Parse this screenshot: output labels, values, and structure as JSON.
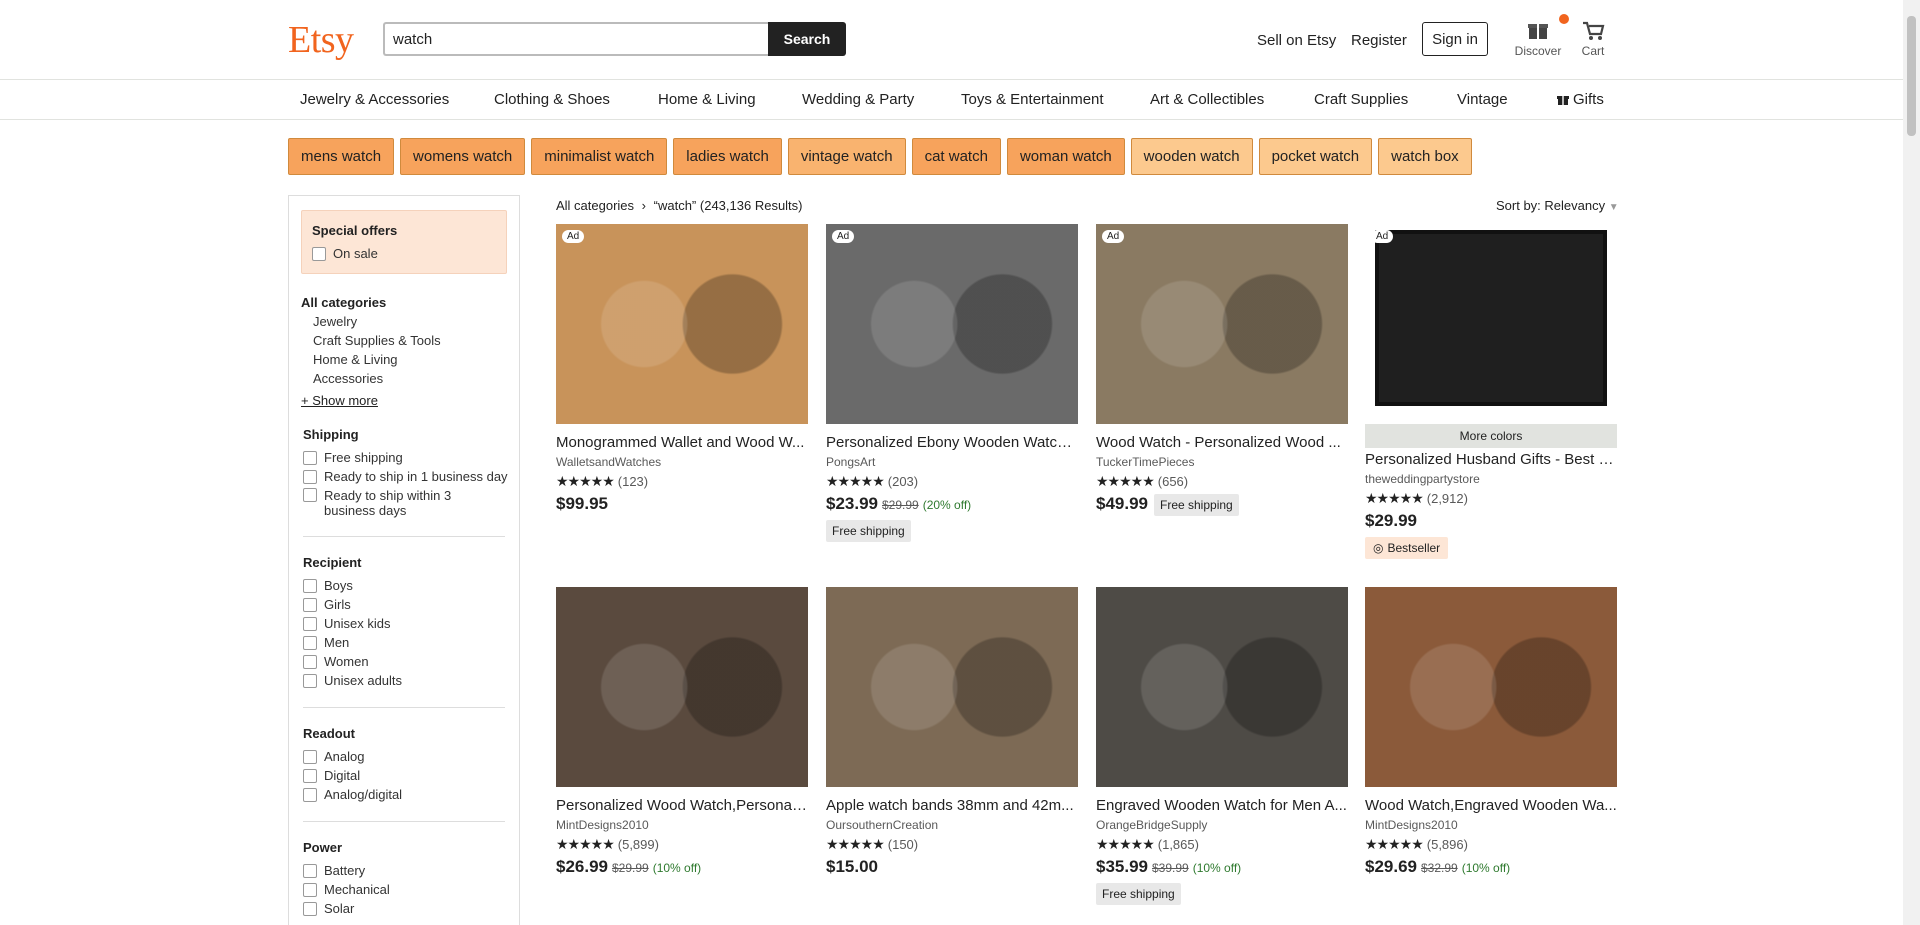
{
  "header": {
    "logo": "Etsy",
    "search_value": "watch",
    "search_button": "Search",
    "sell": "Sell on Etsy",
    "register": "Register",
    "signin": "Sign in",
    "discover": "Discover",
    "cart": "Cart"
  },
  "nav": {
    "categories": [
      "Jewelry & Accessories",
      "Clothing & Shoes",
      "Home & Living",
      "Wedding & Party",
      "Toys & Entertainment",
      "Art & Collectibles",
      "Craft Supplies",
      "Vintage",
      "Gifts"
    ]
  },
  "related_searches": [
    {
      "label": "mens watch",
      "color": "#f7a35c"
    },
    {
      "label": "womens watch",
      "color": "#f7a35c"
    },
    {
      "label": "minimalist watch",
      "color": "#f7a35c"
    },
    {
      "label": "ladies watch",
      "color": "#f7a35c"
    },
    {
      "label": "vintage watch",
      "color": "#f9b36f"
    },
    {
      "label": "cat watch",
      "color": "#f7a35c"
    },
    {
      "label": "woman watch",
      "color": "#f7a35c"
    },
    {
      "label": "wooden watch",
      "color": "#fcc98e"
    },
    {
      "label": "pocket watch",
      "color": "#fcc98e"
    },
    {
      "label": "watch box",
      "color": "#fcc98e"
    }
  ],
  "sidebar": {
    "special_offers": "Special offers",
    "on_sale": "On sale",
    "all_categories": "All categories",
    "categories": [
      "Jewelry",
      "Craft Supplies & Tools",
      "Home & Living",
      "Accessories"
    ],
    "show_more": "+ Show more",
    "shipping_title": "Shipping",
    "shipping": [
      "Free shipping",
      "Ready to ship in 1 business day",
      "Ready to ship within 3 business days"
    ],
    "recipient_title": "Recipient",
    "recipient": [
      "Boys",
      "Girls",
      "Unisex kids",
      "Men",
      "Women",
      "Unisex adults"
    ],
    "readout_title": "Readout",
    "readout": [
      "Analog",
      "Digital",
      "Analog/digital"
    ],
    "power_title": "Power",
    "power": [
      "Battery",
      "Mechanical",
      "Solar"
    ]
  },
  "results": {
    "breadcrumb_root": "All categories",
    "breadcrumb_sep": "›",
    "query": "“watch”",
    "count": "(243,136 Results)",
    "sort": "Sort by: Relevancy"
  },
  "listings": [
    {
      "title": "Monogrammed Wallet and Wood W...",
      "shop": "WalletsandWatches",
      "stars": "★★★★★",
      "reviews": "(123)",
      "price": "$99.95",
      "orig": "",
      "disc": "",
      "ad": "Ad",
      "ship": "",
      "bg": "#c8935a"
    },
    {
      "title": "Personalized Ebony Wooden Watch ...",
      "shop": "PongsArt",
      "stars": "★★★★★",
      "reviews": "(203)",
      "price": "$23.99",
      "orig": "$29.99",
      "disc": "(20% off)",
      "ad": "Ad",
      "ship": "Free shipping",
      "bg": "#6a6a6a"
    },
    {
      "title": "Wood Watch - Personalized Wood ...",
      "shop": "TuckerTimePieces",
      "stars": "★★★★★",
      "reviews": "(656)",
      "price": "$49.99",
      "orig": "",
      "disc": "",
      "ad": "Ad",
      "ship": "Free shipping",
      "bg": "#8a7a62"
    },
    {
      "title": "Personalized Husband Gifts - Best B...",
      "shop": "theweddingpartystore",
      "stars": "★★★★★",
      "reviews": "(2,912)",
      "price": "$29.99",
      "orig": "",
      "disc": "",
      "ad": "Ad",
      "ship": "",
      "bg": "#1f1f1f",
      "more_colors": "More colors",
      "bestseller": "Bestseller"
    },
    {
      "title": "Personalized Wood Watch,Personali...",
      "shop": "MintDesigns2010",
      "stars": "★★★★★",
      "reviews": "(5,899)",
      "price": "$26.99",
      "orig": "$29.99",
      "disc": "(10% off)",
      "ad": "",
      "ship": "",
      "bg": "#5a4a3e"
    },
    {
      "title": "Apple watch bands 38mm and 42m...",
      "shop": "OursouthernCreation",
      "stars": "★★★★★",
      "reviews": "(150)",
      "price": "$15.00",
      "orig": "",
      "disc": "",
      "ad": "",
      "ship": "",
      "bg": "#7d6a55"
    },
    {
      "title": "Engraved Wooden Watch for Men A...",
      "shop": "OrangeBridgeSupply",
      "stars": "★★★★★",
      "reviews": "(1,865)",
      "price": "$35.99",
      "orig": "$39.99",
      "disc": "(10% off)",
      "ad": "",
      "ship": "Free shipping",
      "bg": "#4e4b46"
    },
    {
      "title": "Wood Watch,Engraved Wooden Wa...",
      "shop": "MintDesigns2010",
      "stars": "★★★★★",
      "reviews": "(5,896)",
      "price": "$29.69",
      "orig": "$32.99",
      "disc": "(10% off)",
      "ad": "",
      "ship": "",
      "bg": "#8b5a3a"
    }
  ]
}
